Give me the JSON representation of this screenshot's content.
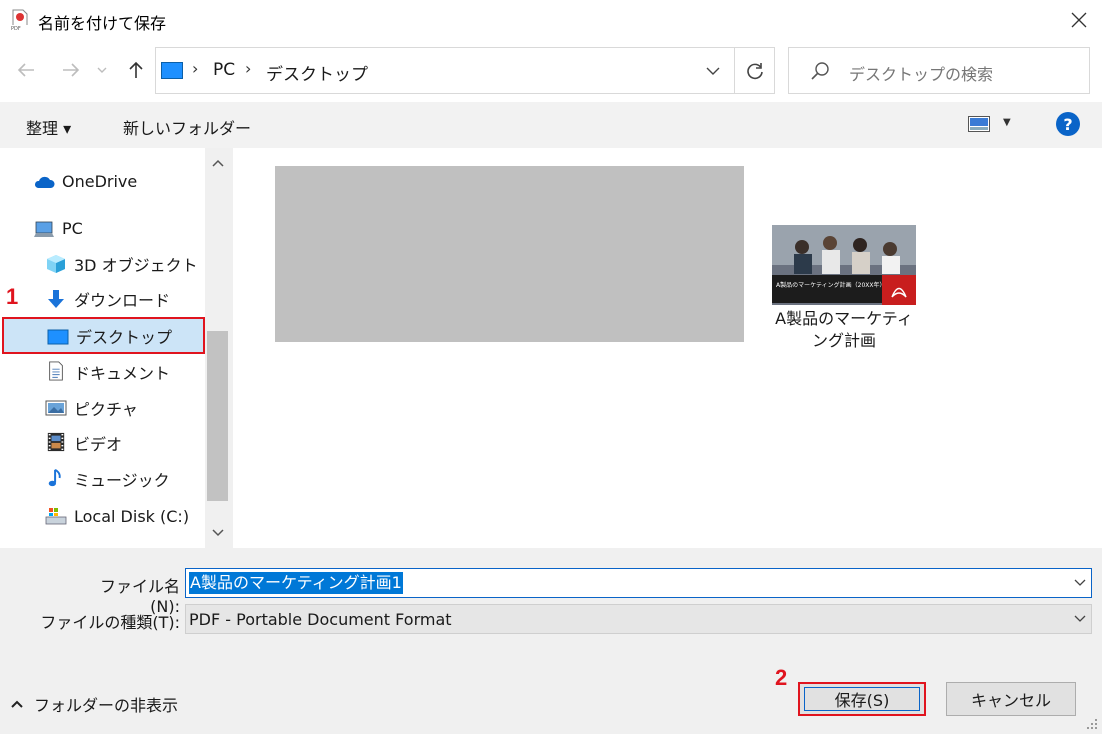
{
  "window": {
    "title": "名前を付けて保存",
    "app_icon": "pdf-app-icon",
    "close_icon": "close-icon"
  },
  "navigation": {
    "back_icon": "arrow-left-icon",
    "forward_icon": "arrow-right-icon",
    "recent_icon": "chevron-down-icon",
    "up_icon": "arrow-up-icon"
  },
  "address": {
    "root": "PC",
    "current": "デスクトップ",
    "refresh_icon": "refresh-icon"
  },
  "search": {
    "placeholder": "デスクトップの検索"
  },
  "toolbar": {
    "organize": "整理 ▾",
    "new_folder": "新しいフォルダー",
    "help": "?"
  },
  "sidebar": {
    "items": [
      {
        "label": "OneDrive",
        "icon": "cloud-icon"
      },
      {
        "label": "PC",
        "icon": "computer-icon"
      },
      {
        "label": "3D オブジェクト",
        "icon": "cube-icon"
      },
      {
        "label": "ダウンロード",
        "icon": "download-arrow-icon"
      },
      {
        "label": "デスクトップ",
        "icon": "desktop-icon",
        "selected": true
      },
      {
        "label": "ドキュメント",
        "icon": "document-icon"
      },
      {
        "label": "ピクチャ",
        "icon": "picture-icon"
      },
      {
        "label": "ビデオ",
        "icon": "video-film-icon"
      },
      {
        "label": "ミュージック",
        "icon": "music-note-icon"
      },
      {
        "label": "Local Disk (C:)",
        "icon": "drive-icon"
      }
    ]
  },
  "annotations": {
    "step1": "1",
    "step2": "2"
  },
  "files": [
    {
      "name": "A製品のマーケティング計画",
      "thumb_caption": "A製品のマーケティング計画（20XX年）"
    }
  ],
  "form": {
    "filename_label": "ファイル名(N):",
    "filename_value": "A製品のマーケティング計画1",
    "filetype_label": "ファイルの種類(T):",
    "filetype_value": "PDF - Portable Document Format"
  },
  "footer": {
    "hide_folders": "フォルダーの非表示",
    "save": "保存(S)",
    "cancel": "キャンセル"
  },
  "colors": {
    "highlight_red": "#e0141e",
    "selection_blue": "#cce4f7",
    "accent_blue": "#0078d7"
  }
}
